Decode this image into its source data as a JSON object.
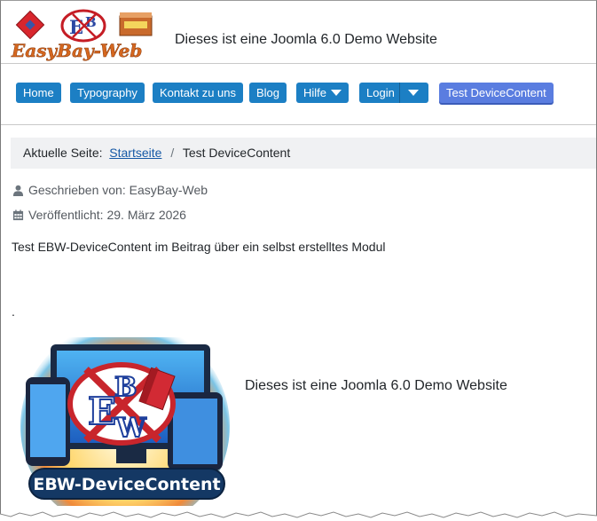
{
  "header": {
    "logo_text": "EasyBay-Web",
    "site_title": "Dieses ist eine Joomla 6.0 Demo Website"
  },
  "nav": {
    "items": [
      {
        "label": "Home"
      },
      {
        "label": "Typography"
      },
      {
        "label": "Kontakt zu uns"
      },
      {
        "label": "Blog"
      },
      {
        "label": "Hilfe"
      },
      {
        "label": "Login"
      },
      {
        "label": "Test DeviceContent"
      }
    ]
  },
  "breadcrumb": {
    "prefix": "Aktuelle Seite:",
    "home": "Startseite",
    "separator": "/",
    "current": "Test DeviceContent"
  },
  "article": {
    "author": "Geschrieben von: EasyBay-Web",
    "published": "Veröffentlicht: 29. März 2026",
    "text": "Test EBW-DeviceContent im Beitrag über ein selbst erstelltes Modul",
    "dot": "."
  },
  "module": {
    "image_label": "EBW-DeviceContent",
    "text": "Dieses ist eine Joomla 6.0 Demo Website"
  },
  "colors": {
    "nav_button": "#1c7fc4",
    "nav_active": "#5a7de0",
    "link": "#1659a6"
  }
}
